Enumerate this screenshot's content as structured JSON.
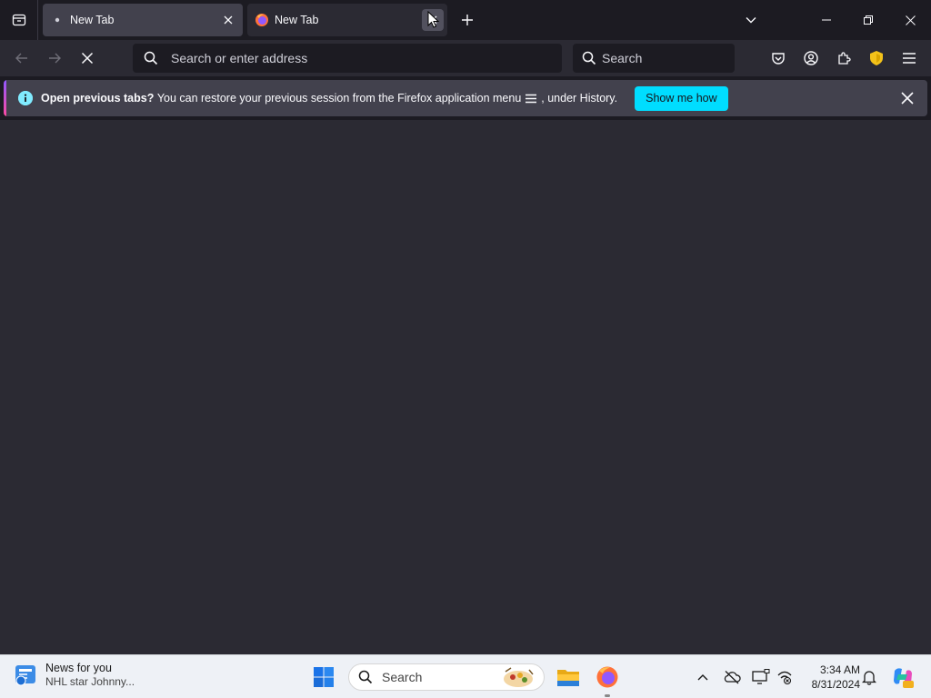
{
  "browser": {
    "tabs": [
      {
        "label": "New Tab",
        "icon": "dot-icon",
        "active": false
      },
      {
        "label": "New Tab",
        "icon": "firefox-icon",
        "active": true,
        "loading": true
      }
    ],
    "urlbar": {
      "placeholder": "Search or enter address"
    },
    "searchbar": {
      "placeholder": "Search"
    },
    "toolbar_icons": [
      "pocket-icon",
      "account-icon",
      "extensions-icon",
      "shield-extension-icon",
      "menu-icon"
    ]
  },
  "notification": {
    "title": "Open previous tabs?",
    "message": "You can restore your previous session from the Firefox application menu",
    "message_suffix": ", under History.",
    "action_label": "Show me how"
  },
  "taskbar": {
    "news_title": "News for you",
    "news_subtitle": "NHL star Johnny...",
    "search_label": "Search",
    "time": "3:34 AM",
    "date": "8/31/2024"
  },
  "colors": {
    "tabstrip_bg": "#1c1b22",
    "toolbar_bg": "#2b2a33",
    "accent": "#00ddff",
    "info_icon": "#80ebff",
    "taskbar_bg": "#eef1f6"
  }
}
